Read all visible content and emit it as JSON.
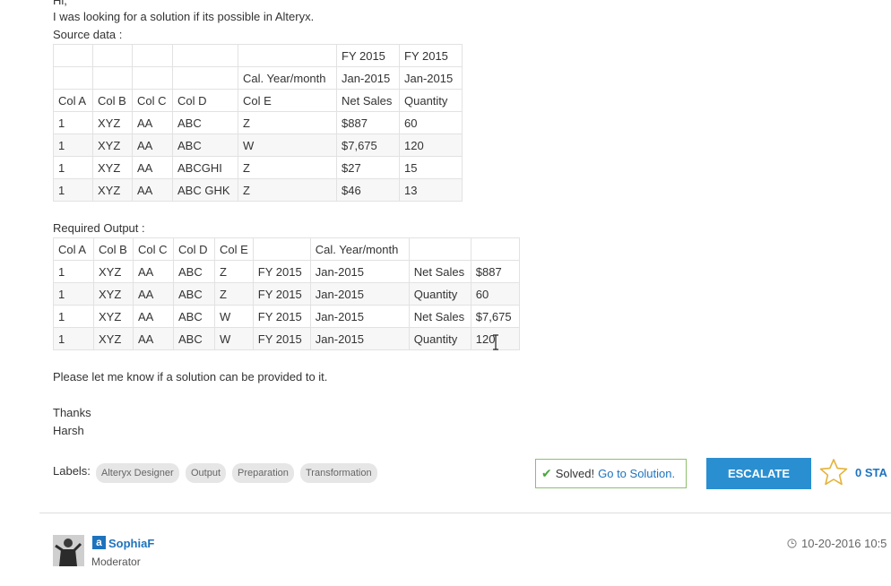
{
  "post": {
    "greeting": "Hi,",
    "intro": "I was looking for a solution if its possible in Alteryx.",
    "source_label": "Source data :",
    "output_label": "Required Output :",
    "closing": "Please let me know if a solution can be provided to it.",
    "thanks": "Thanks",
    "author_sign": "Harsh"
  },
  "source_table": {
    "rows": [
      [
        "",
        "",
        "",
        "",
        "",
        "FY 2015",
        "FY 2015"
      ],
      [
        "",
        "",
        "",
        "",
        "Cal. Year/month",
        "Jan-2015",
        "Jan-2015"
      ],
      [
        "Col A",
        "Col B",
        "Col C",
        "Col D",
        "Col E",
        "Net Sales",
        "Quantity"
      ],
      [
        "1",
        "XYZ",
        "AA",
        "ABC",
        "Z",
        "$887",
        "60"
      ],
      [
        "1",
        "XYZ",
        "AA",
        "ABC",
        "W",
        "$7,675",
        "120"
      ],
      [
        "1",
        "XYZ",
        "AA",
        "ABCGHI",
        "Z",
        "$27",
        "15"
      ],
      [
        "1",
        "XYZ",
        "AA",
        "ABC GHK",
        "Z",
        "$46",
        "13"
      ]
    ]
  },
  "output_table": {
    "rows": [
      [
        "Col A",
        "Col B",
        "Col C",
        "Col D",
        "Col E",
        "",
        "Cal. Year/month",
        "",
        ""
      ],
      [
        "1",
        "XYZ",
        "AA",
        "ABC",
        "Z",
        "FY 2015",
        "Jan-2015",
        "Net Sales",
        "$887"
      ],
      [
        "1",
        "XYZ",
        "AA",
        "ABC",
        "Z",
        "FY 2015",
        "Jan-2015",
        "Quantity",
        "60"
      ],
      [
        "1",
        "XYZ",
        "AA",
        "ABC",
        "W",
        "FY 2015",
        "Jan-2015",
        "Net Sales",
        "$7,675"
      ],
      [
        "1",
        "XYZ",
        "AA",
        "ABC",
        "W",
        "FY 2015",
        "Jan-2015",
        "Quantity",
        "120"
      ]
    ]
  },
  "labels": {
    "title": "Labels:",
    "items": [
      "Alteryx Designer",
      "Output",
      "Preparation",
      "Transformation"
    ]
  },
  "solution": {
    "solved_text": "Solved!",
    "link_text": "Go to Solution."
  },
  "escalate_label": "ESCALATE",
  "star_count": "0 STA",
  "reply": {
    "rank_letter": "a",
    "username": "SophiaF",
    "role": "Moderator",
    "date": "10-20-2016 10:5"
  },
  "colors": {
    "accent": "#2a8fd0",
    "link": "#1e73be",
    "solved_border": "#8cbf6e",
    "check": "#4aa63f"
  },
  "icons": [
    "check-icon",
    "star-icon",
    "clock-icon",
    "rank-icon",
    "avatar",
    "text-cursor-icon"
  ]
}
